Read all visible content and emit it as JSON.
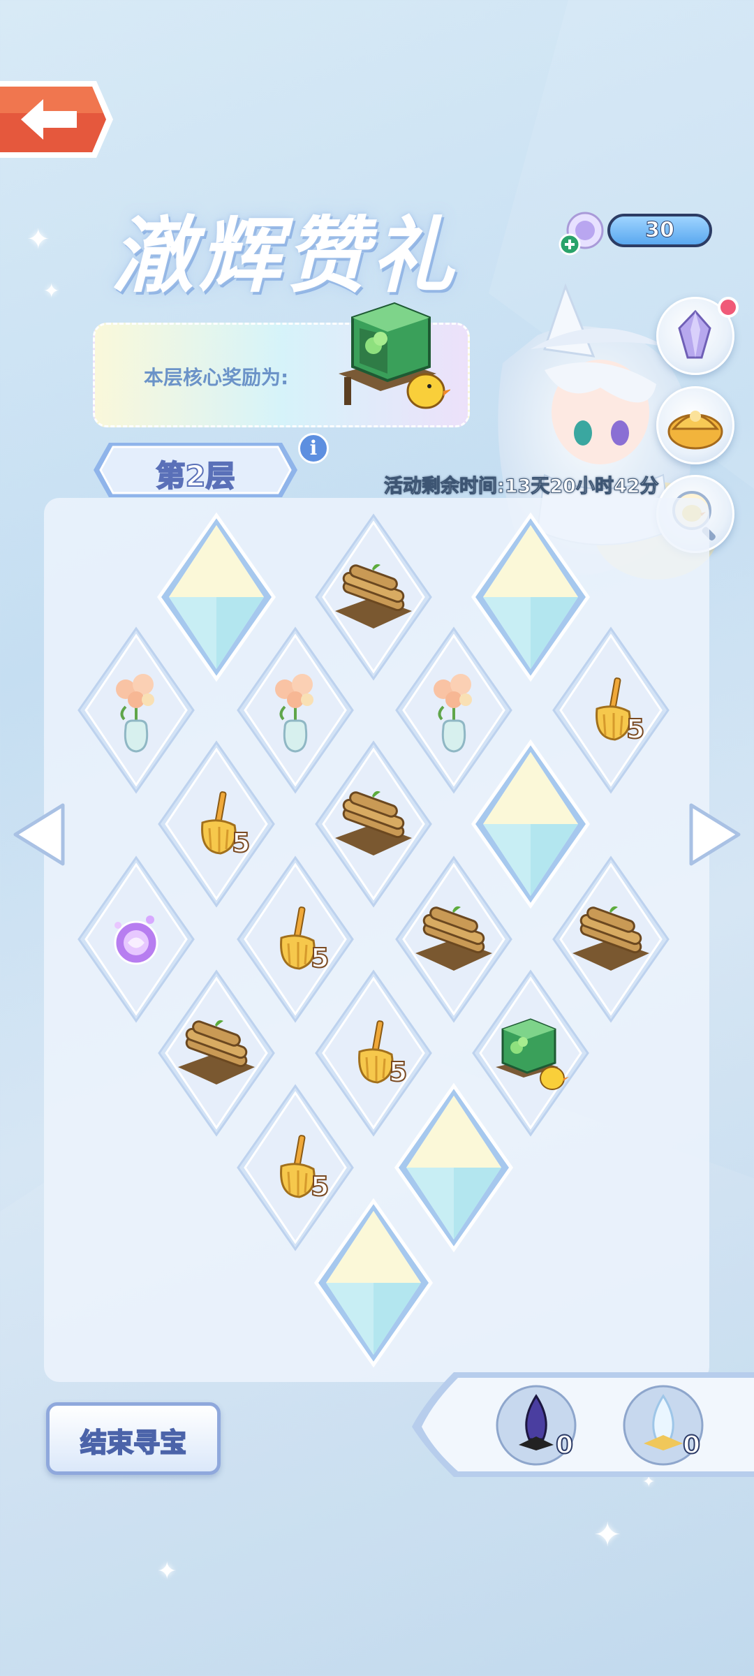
{
  "header": {
    "title": "澈辉赞礼",
    "currency_value": "30"
  },
  "core_reward": {
    "label": "本层核心奖励为:",
    "item_icon": "green-plant-cabinet-icon"
  },
  "floor": {
    "label": "第2层",
    "info_icon": "i"
  },
  "event": {
    "timer_text": "活动剩余时间:13天20小时42分"
  },
  "board": {
    "cells": [
      {
        "type": "crystal-tile",
        "count": ""
      },
      {
        "type": "wood-pile-icon",
        "count": ""
      },
      {
        "type": "crystal-tile",
        "count": ""
      },
      {
        "type": "flower-vase-icon",
        "count": ""
      },
      {
        "type": "flower-vase-icon",
        "count": ""
      },
      {
        "type": "flower-vase-icon",
        "count": ""
      },
      {
        "type": "broom-icon",
        "count": "5"
      },
      {
        "type": "broom-icon",
        "count": "5"
      },
      {
        "type": "wood-pile-icon",
        "count": ""
      },
      {
        "type": "crystal-tile",
        "count": ""
      },
      {
        "type": "purple-orb-icon",
        "count": ""
      },
      {
        "type": "broom-icon",
        "count": "5"
      },
      {
        "type": "wood-pile-icon",
        "count": ""
      },
      {
        "type": "wood-pile-icon",
        "count": ""
      },
      {
        "type": "wood-pile-icon",
        "count": ""
      },
      {
        "type": "broom-icon",
        "count": "5"
      },
      {
        "type": "green-plant-cabinet-icon",
        "count": ""
      },
      {
        "type": "broom-icon",
        "count": "5"
      },
      {
        "type": "crystal-tile",
        "count": ""
      },
      {
        "type": "crystal-tile",
        "count": ""
      }
    ]
  },
  "bottom": {
    "end_button_label": "结束寻宝",
    "resources": [
      {
        "icon": "dark-crystal-icon",
        "count": "0"
      },
      {
        "icon": "light-crystal-icon",
        "count": "0"
      }
    ]
  },
  "colors": {
    "accent_blue": "#5d8fe0",
    "back_button": "#e5583d",
    "count_outline": "#7a4a22"
  }
}
